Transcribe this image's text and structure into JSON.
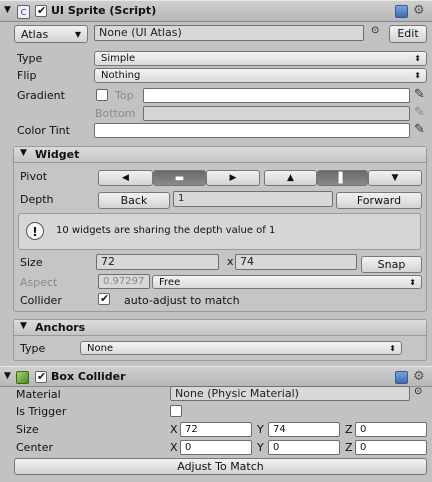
{
  "ui_sprite": {
    "title": "UI Sprite (Script)",
    "atlas_button": "Atlas",
    "atlas_value": "None (UI Atlas)",
    "edit_button": "Edit",
    "type_label": "Type",
    "type_value": "Simple",
    "flip_label": "Flip",
    "flip_value": "Nothing",
    "gradient_label": "Gradient",
    "gradient_top": "Top",
    "gradient_bottom": "Bottom",
    "color_tint_label": "Color Tint"
  },
  "widget": {
    "title": "Widget",
    "pivot_label": "Pivot",
    "pivot_left": "◀",
    "pivot_center_h": "▬",
    "pivot_right": "▶",
    "pivot_up": "▲",
    "pivot_center_v": "▌",
    "pivot_down": "▼",
    "depth_label": "Depth",
    "back_button": "Back",
    "depth_value": "1",
    "forward_button": "Forward",
    "info_message": "10 widgets are sharing the depth value of 1",
    "size_label": "Size",
    "size_w": "72",
    "size_x_sep": "x",
    "size_h": "74",
    "snap_button": "Snap",
    "aspect_label": "Aspect",
    "aspect_value": "0.97297",
    "aspect_mode": "Free",
    "collider_label": "Collider",
    "collider_text": "auto-adjust to match"
  },
  "anchors": {
    "title": "Anchors",
    "type_label": "Type",
    "type_value": "None"
  },
  "box_collider": {
    "title": "Box Collider",
    "material_label": "Material",
    "material_value": "None (Physic Material)",
    "is_trigger_label": "Is Trigger",
    "size_label": "Size",
    "size_x": "72",
    "size_y": "74",
    "size_z": "0",
    "center_label": "Center",
    "center_x": "0",
    "center_y": "0",
    "center_z": "0",
    "axis_x": "X",
    "axis_y": "Y",
    "axis_z": "Z",
    "adjust_button": "Adjust To Match"
  },
  "icons": {
    "foldout": "triangle-down",
    "script": "script-icon",
    "help": "help-icon",
    "gear": "gear-icon",
    "picker": "eyedropper-icon",
    "info": "info-icon",
    "collider": "cube-icon"
  }
}
